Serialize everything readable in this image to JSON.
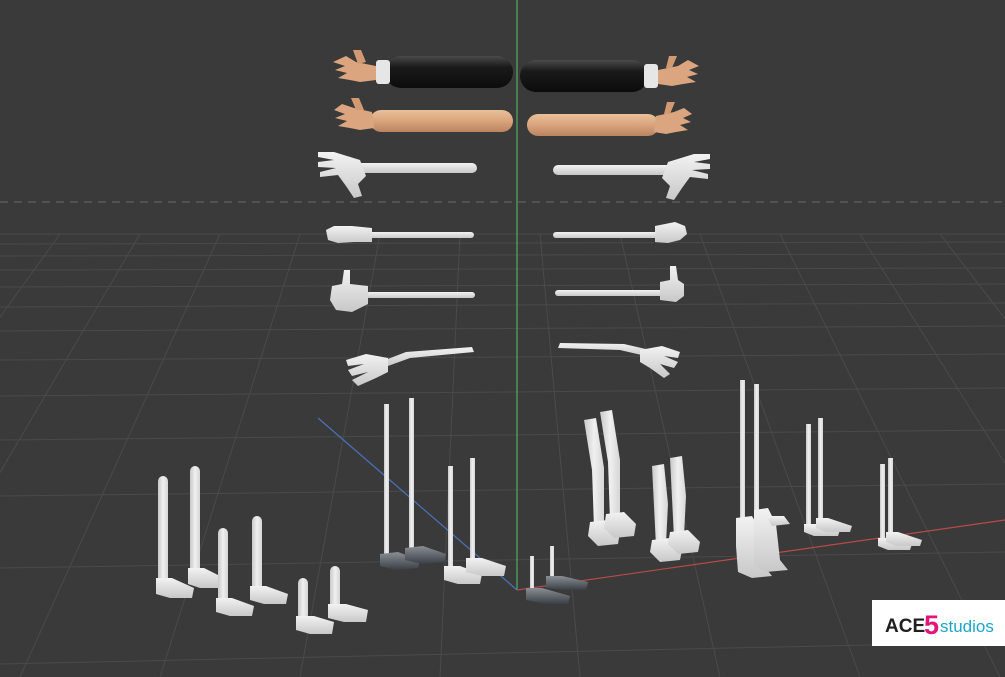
{
  "viewport": {
    "background": "#3a3a3a",
    "grid_color": "#4a4a4a",
    "axis_colors": {
      "x": "#b84a4a",
      "y": "#4a72b8",
      "z": "#4fae5c"
    },
    "horizon": "dashed"
  },
  "models": {
    "arms": [
      {
        "name": "suit-arm",
        "sleeve": "black",
        "count": 2
      },
      {
        "name": "bare-skin-arm",
        "sleeve": "none",
        "count": 2
      },
      {
        "name": "white-open-hand-arm",
        "count": 2
      },
      {
        "name": "white-fist-arm",
        "count": 2
      },
      {
        "name": "white-thumb-arm",
        "count": 2
      },
      {
        "name": "white-curved-arm",
        "count": 2
      }
    ],
    "legs": [
      {
        "name": "white-sock-legs",
        "count": 4
      },
      {
        "name": "dark-shoe-legs",
        "count": 3
      },
      {
        "name": "thick-boot-legs",
        "count": 4
      },
      {
        "name": "thin-foot-legs",
        "count": 3
      }
    ],
    "colors": {
      "suit": "#161616",
      "skin": "#d7a27a",
      "white_model": "#e8e8e8",
      "shoe_dark": "#4a4e55"
    }
  },
  "watermark": {
    "prefix": "ACE",
    "number": "5",
    "suffix": "studios",
    "accent": "#e2157b"
  }
}
